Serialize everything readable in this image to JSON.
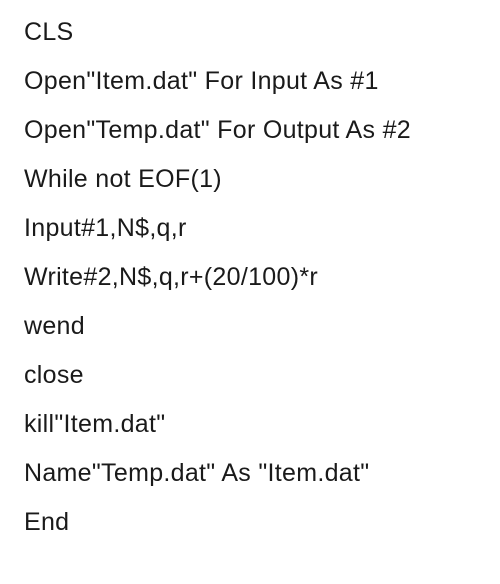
{
  "code": {
    "lines": [
      "CLS",
      "Open\"Item.dat\" For Input As #1",
      "Open\"Temp.dat\" For Output As #2",
      "While not EOF(1)",
      "Input#1,N$,q,r",
      "Write#2,N$,q,r+(20/100)*r",
      "wend",
      "close",
      "kill\"Item.dat\"",
      "Name\"Temp.dat\" As \"Item.dat\"",
      "End"
    ]
  }
}
